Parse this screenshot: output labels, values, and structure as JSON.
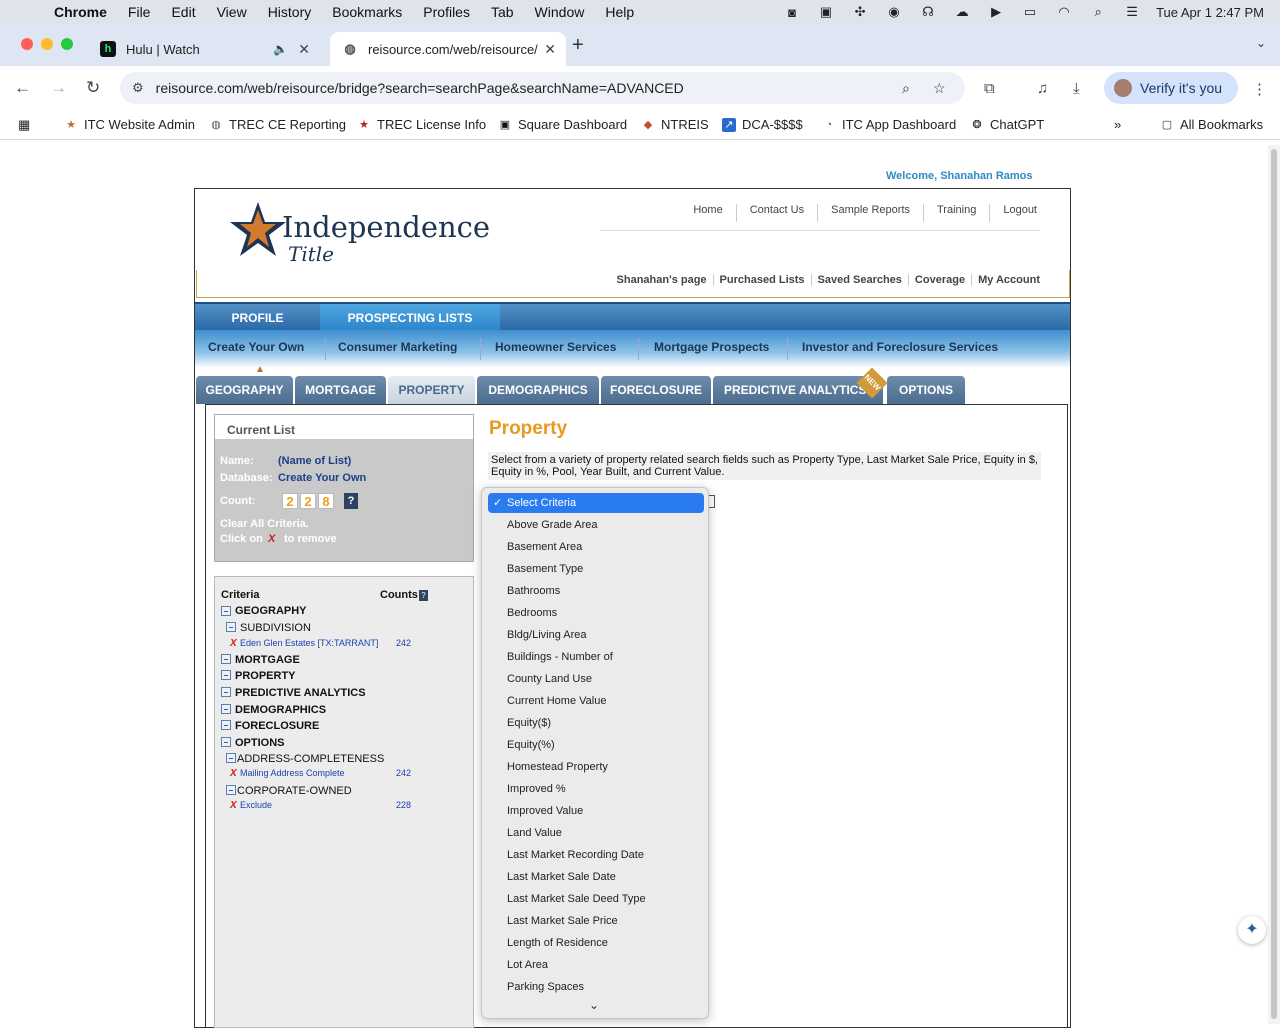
{
  "os_menubar": {
    "app": "Chrome",
    "items": [
      "File",
      "Edit",
      "View",
      "History",
      "Bookmarks",
      "Profiles",
      "Tab",
      "Window",
      "Help"
    ],
    "clock": "Tue Apr 1  2:47 PM"
  },
  "browser": {
    "tabs": [
      {
        "title": "Hulu | Watch",
        "favicon": "h"
      },
      {
        "title": "reisource.com/web/reisource/",
        "favicon": "globe"
      }
    ],
    "url": "reisource.com/web/reisource/bridge?search=searchPage&searchName=ADVANCED",
    "verify_label": "Verify it's you",
    "bookmarks": [
      "ITC Website Admin",
      "TREC CE Reporting",
      "TREC License Info",
      "Square Dashboard",
      "NTREIS",
      "DCA-$$$$",
      "ITC App Dashboard",
      "ChatGPT"
    ],
    "all_bookmarks": "All Bookmarks"
  },
  "page": {
    "welcome": "Welcome, Shanahan Ramos",
    "logo": {
      "word": "Independence",
      "sub": "Title"
    },
    "top_links": [
      "Home",
      "Contact Us",
      "Sample Reports",
      "Training",
      "Logout"
    ],
    "user_links": [
      "Shanahan's page",
      "Purchased Lists",
      "Saved Searches",
      "Coverage",
      "My Account"
    ],
    "main_nav": [
      "PROFILE",
      "PROSPECTING LISTS"
    ],
    "sub_nav": [
      "Create Your Own",
      "Consumer Marketing",
      "Homeowner Services",
      "Mortgage Prospects",
      "Investor and Foreclosure Services"
    ],
    "tabs": [
      "GEOGRAPHY",
      "MORTGAGE",
      "PROPERTY",
      "DEMOGRAPHICS",
      "FORECLOSURE",
      "PREDICTIVE ANALYTICS",
      "OPTIONS"
    ],
    "new_badge": "NEW",
    "current_list": {
      "heading": "Current List",
      "name_label": "Name:",
      "name_value": "(Name of List)",
      "db_label": "Database:",
      "db_value": "Create Your Own",
      "count_label": "Count:",
      "count_digits": [
        "2",
        "2",
        "8"
      ],
      "help": "?",
      "clear": "Clear All Criteria.",
      "click_on": "Click on",
      "x": "X",
      "to_remove": "to remove"
    },
    "criteria": {
      "col1": "Criteria",
      "col2": "Counts",
      "help": "?",
      "rows": {
        "geography": "GEOGRAPHY",
        "subdivision": "SUBDIVISION",
        "eden": "Eden Glen Estates [TX:TARRANT]",
        "eden_count": "242",
        "mortgage": "MORTGAGE",
        "property": "PROPERTY",
        "predictive": "PREDICTIVE ANALYTICS",
        "demographics": "DEMOGRAPHICS",
        "foreclosure": "FORECLOSURE",
        "options": "OPTIONS",
        "addr": "ADDRESS-COMPLETENESS",
        "mailing": "Mailing Address Complete",
        "mailing_count": "242",
        "corp": "CORPORATE-OWNED",
        "exclude": "Exclude",
        "exclude_count": "228"
      }
    },
    "property": {
      "title": "Property",
      "description": "Select from a variety of property related search fields such as Property Type, Last Market Sale Price, Equity in $, Equity in %, Pool, Year Built, and Current Value."
    },
    "dropdown": {
      "selected": "Select Criteria",
      "options": [
        "Select Criteria",
        "Above Grade Area",
        "Basement Area",
        "Basement Type",
        "Bathrooms",
        "Bedrooms",
        "Bldg/Living Area",
        "Buildings - Number of",
        "County Land Use",
        "Current Home Value",
        "Equity($)",
        "Equity(%)",
        "Homestead Property",
        "Improved %",
        "Improved Value",
        "Land Value",
        "Last Market Recording Date",
        "Last Market Sale Date",
        "Last Market Sale Deed Type",
        "Last Market Sale Price",
        "Length of Residence",
        "Lot Area",
        "Parking Spaces"
      ]
    }
  },
  "colors": {
    "accent": "#2a7bf0",
    "title_orange": "#e89a1f",
    "nav_blue": "#2a6aa8",
    "link_blue": "#1b3fb0"
  }
}
